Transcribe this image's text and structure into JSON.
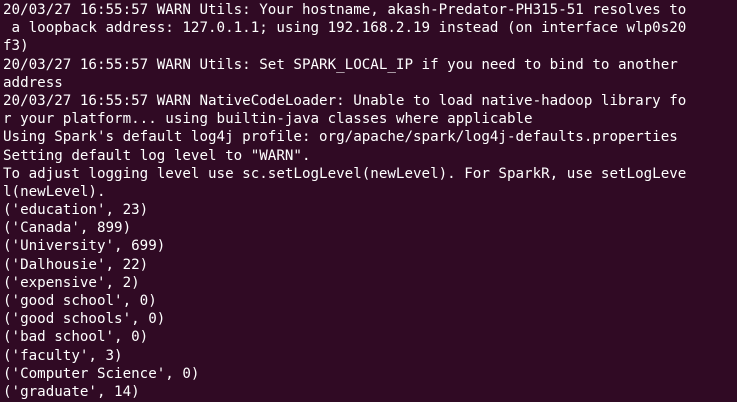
{
  "terminal": {
    "lines": [
      "20/03/27 16:55:57 WARN Utils: Your hostname, akash-Predator-PH315-51 resolves to",
      " a loopback address: 127.0.1.1; using 192.168.2.19 instead (on interface wlp0s20",
      "f3)",
      "20/03/27 16:55:57 WARN Utils: Set SPARK_LOCAL_IP if you need to bind to another",
      "address",
      "20/03/27 16:55:57 WARN NativeCodeLoader: Unable to load native-hadoop library fo",
      "r your platform... using builtin-java classes where applicable",
      "Using Spark's default log4j profile: org/apache/spark/log4j-defaults.properties",
      "Setting default log level to \"WARN\".",
      "To adjust logging level use sc.setLogLevel(newLevel). For SparkR, use setLogLeve",
      "l(newLevel).",
      "('education', 23)",
      "('Canada', 899)",
      "('University', 699)",
      "('Dalhousie', 22)",
      "('expensive', 2)",
      "('good school', 0)",
      "('good schools', 0)",
      "('bad school', 0)",
      "('faculty', 3)",
      "('Computer Science', 0)",
      "('graduate', 14)"
    ]
  }
}
